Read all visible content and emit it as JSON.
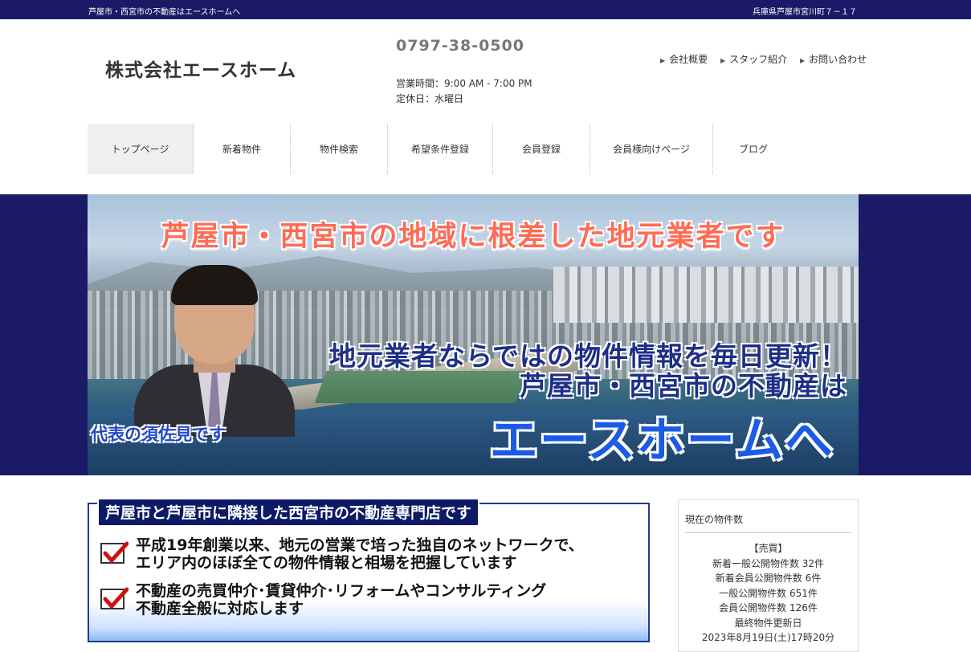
{
  "topbar": {
    "left_text": "芦屋市・西宮市の不動産はエースホームへ",
    "right_text": "兵庫県芦屋市宮川町７－１７"
  },
  "header": {
    "logo": "株式会社エースホーム",
    "phone": "0797-38-0500",
    "hours": "営業時間：9:00 AM - 7:00 PM",
    "holiday": "定休日：水曜日",
    "links": [
      {
        "label": "会社概要",
        "icon": "triangle-right-icon"
      },
      {
        "label": "スタッフ紹介",
        "icon": "triangle-right-icon"
      },
      {
        "label": "お問い合わせ",
        "icon": "triangle-right-icon"
      }
    ]
  },
  "nav": {
    "items": [
      {
        "label": "トップページ",
        "active": true
      },
      {
        "label": "新着物件"
      },
      {
        "label": "物件検索"
      },
      {
        "label": "希望条件登録"
      },
      {
        "label": "会員登録"
      },
      {
        "label": "会員様向けページ"
      },
      {
        "label": "ブログ"
      }
    ]
  },
  "hero": {
    "headline": "芦屋市・西宮市の地域に根差した地元業者です",
    "line2": "地元業者ならではの物件情報を毎日更新！",
    "line3": "芦屋市・西宮市の不動産は",
    "line4": "エースホームへ",
    "caption": "代表の須佐見です"
  },
  "banner": {
    "heading": "芦屋市と芦屋市に隣接した西宮市の不動産専門店です",
    "point1_line1": "平成19年創業以来、地元の営業で培った独自のネットワークで、",
    "point1_line2": "エリア内のほぼ全ての物件情報と相場を把握しています",
    "point2_line1": "不動産の売買仲介･賃貸仲介･リフォームやコンサルティング",
    "point2_line2": "不動産全般に対応します",
    "check_icon": "checkmark-icon"
  },
  "sidebar": {
    "title": "現在の物件数",
    "section": "【売買】",
    "stats": [
      "新着一般公開物件数 32件",
      "新着会員公開物件数 6件",
      "一般公開物件数 651件",
      "会員公開物件数 126件",
      "最終物件更新日",
      "2023年8月19日(土)17時20分"
    ]
  },
  "colors": {
    "topbar": "#1a1a66",
    "hero_band": "#1a1a66",
    "headline_red": "#ff6b55",
    "navy_text": "#1d2f86",
    "brand_blue": "#1b5be5",
    "check_red": "#cc1111"
  }
}
